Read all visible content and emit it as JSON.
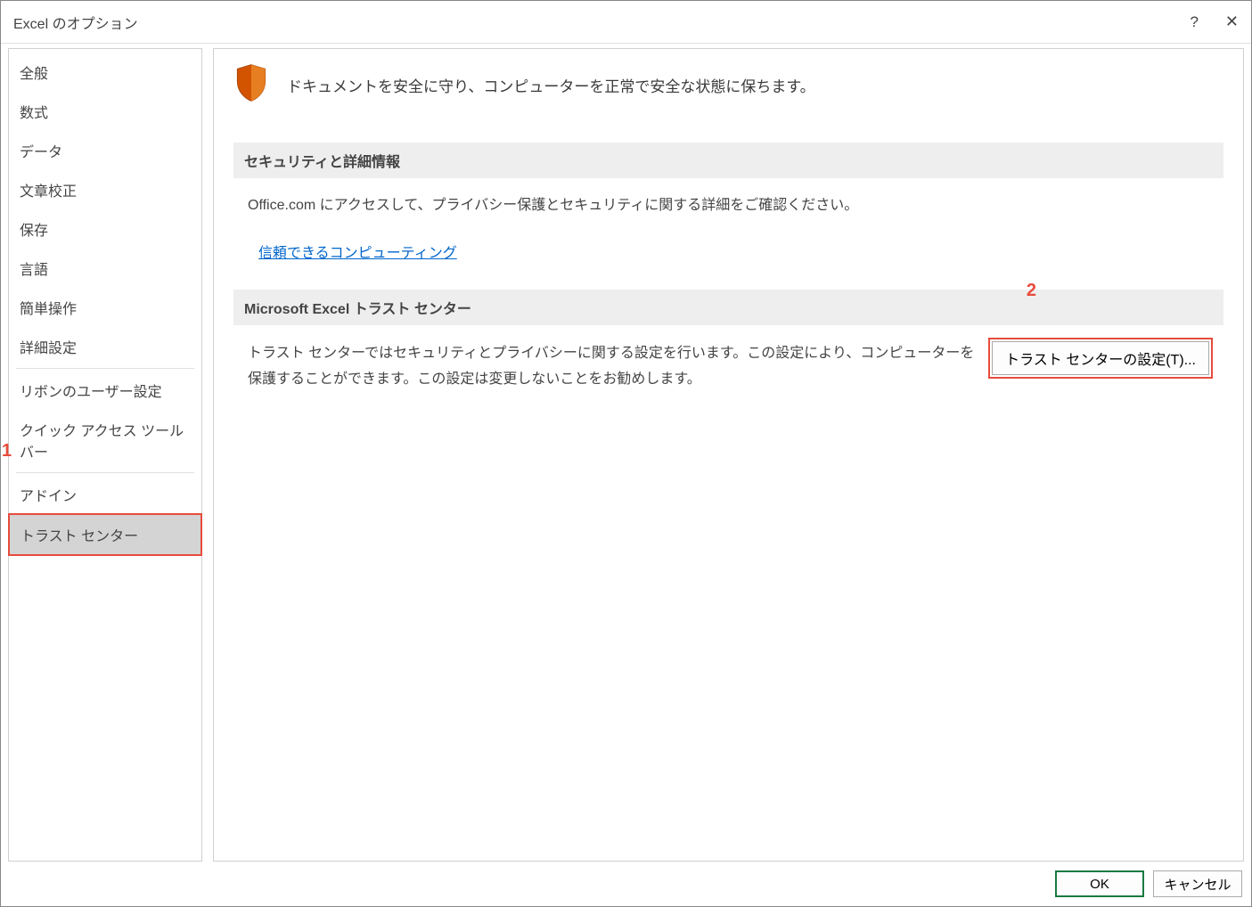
{
  "titlebar": {
    "title": "Excel のオプション",
    "help": "?",
    "close": "✕"
  },
  "sidebar": {
    "items": [
      {
        "label": "全般"
      },
      {
        "label": "数式"
      },
      {
        "label": "データ"
      },
      {
        "label": "文章校正"
      },
      {
        "label": "保存"
      },
      {
        "label": "言語"
      },
      {
        "label": "簡単操作"
      },
      {
        "label": "詳細設定"
      },
      {
        "label": "リボンのユーザー設定"
      },
      {
        "label": "クイック アクセス ツール バー"
      },
      {
        "label": "アドイン"
      },
      {
        "label": "トラスト センター"
      }
    ]
  },
  "main": {
    "header_text": "ドキュメントを安全に守り、コンピューターを正常で安全な状態に保ちます。",
    "section1": {
      "title": "セキュリティと詳細情報",
      "body": "Office.com にアクセスして、プライバシー保護とセキュリティに関する詳細をご確認ください。",
      "link": "信頼できるコンピューティング"
    },
    "section2": {
      "title": "Microsoft Excel トラスト センター",
      "body": "トラスト センターではセキュリティとプライバシーに関する設定を行います。この設定により、コンピューターを保護することができます。この設定は変更しないことをお勧めします。",
      "button": "トラスト センターの設定(T)..."
    }
  },
  "footer": {
    "ok": "OK",
    "cancel": "キャンセル"
  },
  "annotations": {
    "one": "1",
    "two": "2"
  }
}
